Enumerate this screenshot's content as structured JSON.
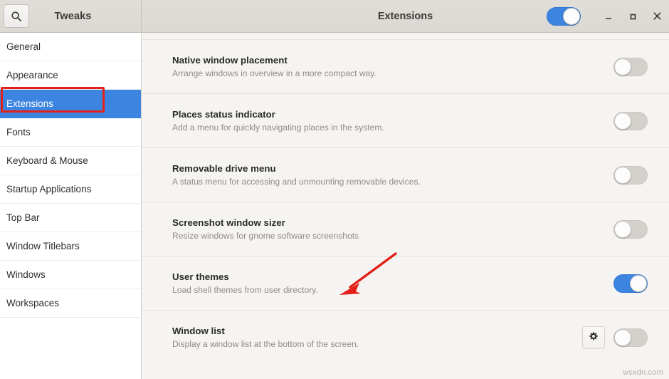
{
  "window": {
    "app_title": "Tweaks",
    "page_title": "Extensions",
    "search_icon": "search-icon",
    "header_switch": {
      "label": "Extensions master switch",
      "state": "on"
    },
    "controls": {
      "minimize": "minimize-icon",
      "maximize": "maximize-icon",
      "close": "close-icon"
    }
  },
  "sidebar": {
    "items": [
      {
        "label": "General",
        "selected": false
      },
      {
        "label": "Appearance",
        "selected": false
      },
      {
        "label": "Extensions",
        "selected": true
      },
      {
        "label": "Fonts",
        "selected": false
      },
      {
        "label": "Keyboard & Mouse",
        "selected": false
      },
      {
        "label": "Startup Applications",
        "selected": false
      },
      {
        "label": "Top Bar",
        "selected": false
      },
      {
        "label": "Window Titlebars",
        "selected": false
      },
      {
        "label": "Windows",
        "selected": false
      },
      {
        "label": "Workspaces",
        "selected": false
      }
    ]
  },
  "extensions": [
    {
      "title": "Native window placement",
      "subtitle": "Arrange windows in overview in a more compact way.",
      "state": "off",
      "has_settings": false
    },
    {
      "title": "Places status indicator",
      "subtitle": "Add a menu for quickly navigating places in the system.",
      "state": "off",
      "has_settings": false
    },
    {
      "title": "Removable drive menu",
      "subtitle": "A status menu for accessing and unmounting removable devices.",
      "state": "off",
      "has_settings": false
    },
    {
      "title": "Screenshot window sizer",
      "subtitle": "Resize windows for gnome software screenshots",
      "state": "off",
      "has_settings": false
    },
    {
      "title": "User themes",
      "subtitle": "Load shell themes from user directory.",
      "state": "on",
      "has_settings": false
    },
    {
      "title": "Window list",
      "subtitle": "Display a window list at the bottom of the screen.",
      "state": "off",
      "has_settings": true,
      "settings_icon": "gear-icon"
    }
  ],
  "annotations": {
    "highlight_target": "Extensions",
    "arrow_target": "User themes",
    "color": "#e32119"
  },
  "watermark": "wsxdn.com"
}
